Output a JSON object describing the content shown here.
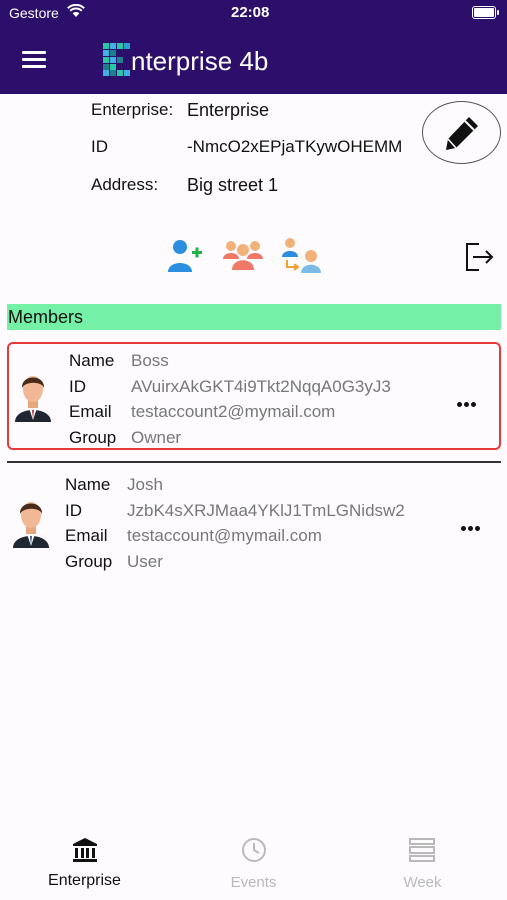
{
  "status_bar": {
    "carrier": "Gestore",
    "time": "22:08"
  },
  "header": {
    "title": "nterprise 4b"
  },
  "enterprise": {
    "name_label": "Enterprise:",
    "name_value": "Enterprise",
    "id_label": "ID",
    "id_value": "-NmcO2xEPjaTKywOHEMM",
    "address_label": "Address:",
    "address_value": "Big street 1"
  },
  "members_section": {
    "title": "Members"
  },
  "field_labels": {
    "name": "Name",
    "id": "ID",
    "email": "Email",
    "group": "Group"
  },
  "members": [
    {
      "name": "Boss",
      "id": "AVuirxAkGKT4i9Tkt2NqqA0G3yJ3",
      "email": "testaccount2@mymail.com",
      "group": "Owner"
    },
    {
      "name": "Josh",
      "id": "JzbK4sXRJMaa4YKlJ1TmLGNidsw2",
      "email": "testaccount@mymail.com",
      "group": "User"
    }
  ],
  "tabs": [
    {
      "label": "Enterprise",
      "icon": "bank-icon",
      "active": true
    },
    {
      "label": "Events",
      "icon": "clock-icon",
      "active": false
    },
    {
      "label": "Week",
      "icon": "week-icon",
      "active": false
    }
  ],
  "colors": {
    "header": "#2c0f6a",
    "members_bar": "#74f0a7",
    "selected_border": "#e53a38",
    "active_tab": "#111111",
    "inactive_tab": "#b9b9b9"
  }
}
